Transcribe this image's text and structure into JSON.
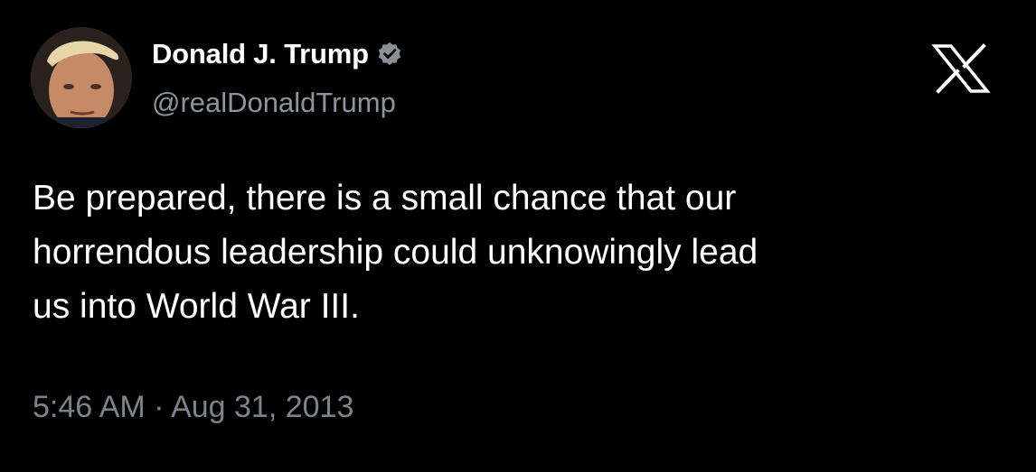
{
  "post": {
    "author": {
      "display_name": "Donald J. Trump",
      "handle": "@realDonaldTrump",
      "verified_icon": "verified-badge-icon",
      "avatar": "avatar-photo"
    },
    "platform_logo": "x-logo-icon",
    "text_lines": [
      "Be prepared, there is a small chance that our",
      "horrendous leadership could unknowingly lead",
      "us into World War III."
    ],
    "timestamp": "5:46 AM · Aug 31, 2013"
  },
  "colors": {
    "background": "#000000",
    "text_primary": "#ffffff",
    "text_secondary": "#8b949c",
    "verified_badge": "#8a9096"
  }
}
